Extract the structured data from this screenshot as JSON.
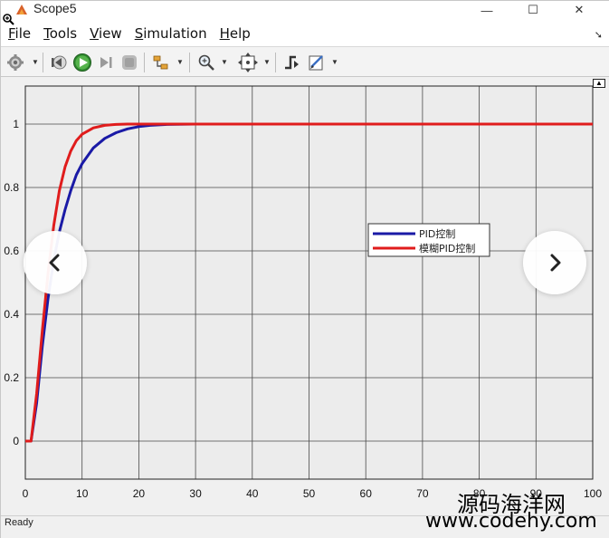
{
  "window": {
    "title": "Scope5",
    "controls": {
      "minimize": "—",
      "maximize": "☐",
      "close": "✕"
    }
  },
  "menubar": {
    "items": [
      {
        "first": "F",
        "rest": "ile"
      },
      {
        "first": "T",
        "rest": "ools"
      },
      {
        "first": "V",
        "rest": "iew"
      },
      {
        "first": "S",
        "rest": "imulation"
      },
      {
        "first": "H",
        "rest": "elp"
      }
    ]
  },
  "toolbar": {
    "icons": [
      "settings-icon",
      "step-back-icon",
      "run-icon",
      "step-forward-icon",
      "stop-icon",
      "highlight-icon",
      "zoom-icon",
      "autoscale-icon",
      "triggers-icon",
      "style-icon"
    ]
  },
  "chart_data": {
    "type": "line",
    "title": "",
    "xlabel": "",
    "ylabel": "",
    "xlim": [
      0,
      100
    ],
    "ylim": [
      -0.12,
      1.12
    ],
    "x_ticks": [
      0,
      10,
      20,
      30,
      40,
      50,
      60,
      70,
      80,
      90,
      100
    ],
    "y_ticks": [
      0,
      0.2,
      0.4,
      0.6,
      0.8,
      1
    ],
    "y_tick_labels": [
      "0",
      "0.2",
      "0.4",
      "0.6",
      "0.8",
      "1"
    ],
    "grid": true,
    "legend_position": "center-right",
    "series": [
      {
        "name": "PID控制",
        "color": "#1a1aa6",
        "x": [
          0,
          1,
          2,
          3,
          4,
          5,
          6,
          7,
          8,
          9,
          10,
          12,
          14,
          16,
          18,
          20,
          22,
          25,
          30,
          40,
          50,
          60,
          70,
          80,
          90,
          100
        ],
        "y": [
          0,
          0,
          0.12,
          0.3,
          0.45,
          0.57,
          0.66,
          0.73,
          0.79,
          0.84,
          0.875,
          0.925,
          0.955,
          0.973,
          0.985,
          0.992,
          0.996,
          0.999,
          1,
          1,
          1,
          1,
          1,
          1,
          1,
          1
        ]
      },
      {
        "name": "模糊PID控制",
        "color": "#e01c1c",
        "x": [
          0,
          1,
          2,
          3,
          4,
          5,
          6,
          7,
          8,
          9,
          10,
          12,
          14,
          16,
          18,
          20,
          25,
          30,
          40,
          50,
          60,
          70,
          80,
          90,
          100
        ],
        "y": [
          0,
          0,
          0.15,
          0.35,
          0.53,
          0.68,
          0.79,
          0.865,
          0.915,
          0.948,
          0.968,
          0.988,
          0.996,
          0.999,
          1,
          1,
          1,
          1,
          1,
          1,
          1,
          1,
          1,
          1,
          1
        ]
      }
    ]
  },
  "statusbar": {
    "text": "Ready"
  },
  "overlay": {
    "prev_glyph": "‹",
    "next_glyph": "›"
  },
  "watermark": {
    "line1": "源码海洋网",
    "line2": "www.codehy.com"
  },
  "colors": {
    "plot_background": "#ececec",
    "grid": "#4a4a4a",
    "axes_frame": "#222222"
  }
}
